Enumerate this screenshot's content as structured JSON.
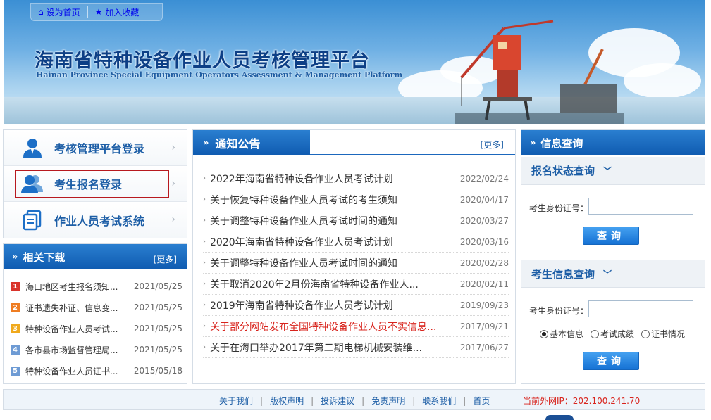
{
  "topbar": {
    "home_label": "设为首页",
    "fav_label": "加入收藏"
  },
  "banner": {
    "title": "海南省特种设备作业人员考核管理平台",
    "subtitle": "Hainan Province Special Equipment Operators Assessment & Management Platform"
  },
  "login_menu": {
    "items": [
      {
        "label": "考核管理平台登录",
        "icon": "user-icon"
      },
      {
        "label": "考生报名登录",
        "icon": "users-icon"
      },
      {
        "label": "作业人员考试系统",
        "icon": "document-icon"
      }
    ]
  },
  "downloads": {
    "title": "相关下载",
    "more": "[更多]",
    "items": [
      {
        "num": "1",
        "color": "#d9342b",
        "title": "海口地区考生报名须知...",
        "date": "2021/05/25"
      },
      {
        "num": "2",
        "color": "#ef7d22",
        "title": "证书遗失补证、信息变...",
        "date": "2021/05/25"
      },
      {
        "num": "3",
        "color": "#f0a91c",
        "title": "特种设备作业人员考试...",
        "date": "2021/05/25"
      },
      {
        "num": "4",
        "color": "#6e9bd4",
        "title": "各市县市场监督管理局...",
        "date": "2021/05/25"
      },
      {
        "num": "5",
        "color": "#6e9bd4",
        "title": "特种设备作业人员证书...",
        "date": "2015/05/18"
      }
    ]
  },
  "notices": {
    "title": "通知公告",
    "more": "[更多]",
    "items": [
      {
        "title": "2022年海南省特种设备作业人员考试计划",
        "date": "2022/02/24",
        "red": false
      },
      {
        "title": "关于恢复特种设备作业人员考试的考生须知",
        "date": "2020/04/17",
        "red": false
      },
      {
        "title": "关于调整特种设备作业人员考试时间的通知",
        "date": "2020/03/27",
        "red": false
      },
      {
        "title": "2020年海南省特种设备作业人员考试计划",
        "date": "2020/03/16",
        "red": false
      },
      {
        "title": "关于调整特种设备作业人员考试时间的通知",
        "date": "2020/02/28",
        "red": false
      },
      {
        "title": "关于取消2020年2月份海南省特种设备作业人...",
        "date": "2020/02/11",
        "red": false
      },
      {
        "title": "2019年海南省特种设备作业人员考试计划",
        "date": "2019/09/23",
        "red": false
      },
      {
        "title": "关于部分网站发布全国特种设备作业人员不实信息...",
        "date": "2017/09/21",
        "red": true
      },
      {
        "title": "关于在海口举办2017年第二期电梯机械安装维...",
        "date": "2017/06/27",
        "red": false
      }
    ]
  },
  "query": {
    "title": "信息查询",
    "status_section": {
      "title": "报名状态查询",
      "id_label": "考生身份证号：",
      "id_value": "",
      "button": "查询"
    },
    "info_section": {
      "title": "考生信息查询",
      "id_label": "考生身份证号：",
      "id_value": "",
      "options": [
        "基本信息",
        "考试成绩",
        "证书情况"
      ],
      "selected": "基本信息",
      "button": "查询"
    }
  },
  "footer": {
    "links": [
      "关于我们",
      "版权声明",
      "投诉建议",
      "免责声明",
      "联系我们",
      "首页"
    ],
    "separator": "|",
    "ip_text": "当前外网IP：202.100.241.70"
  },
  "colors": {
    "brand_blue": "#1d5ea6",
    "header_blue": "#0f5bb0",
    "highlight_red": "#b8191f",
    "notice_red": "#d8241d"
  }
}
